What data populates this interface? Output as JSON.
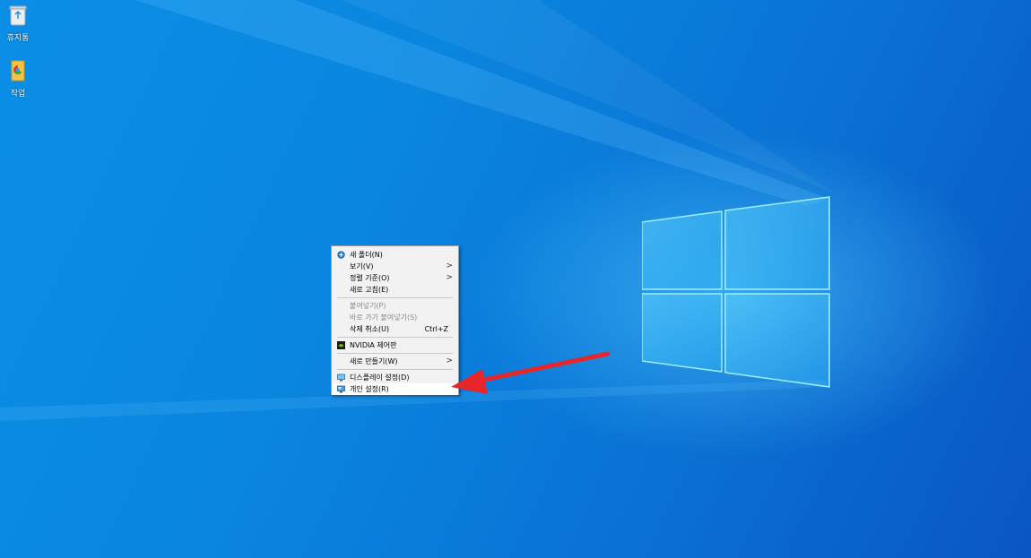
{
  "desktop": {
    "icons": [
      {
        "label": "휴지통",
        "icon": "recycle-bin-icon"
      },
      {
        "label": "작업",
        "icon": "folder-icon"
      }
    ],
    "logo": "windows-logo"
  },
  "context_menu": {
    "items": [
      {
        "label": "새 폴더(N)",
        "icon": "new-folder-icon"
      },
      {
        "label": "보기(V)",
        "submenu": ">"
      },
      {
        "label": "정렬 기준(O)",
        "submenu": ">"
      },
      {
        "label": "새로 고침(E)"
      },
      {
        "label": "붙여넣기(P)",
        "disabled": true
      },
      {
        "label": "바로 가기 붙여넣기(S)",
        "disabled": true
      },
      {
        "label": "삭제 취소(U)",
        "shortcut": "Ctrl+Z"
      },
      {
        "label": "NVIDIA 제어판",
        "icon": "nvidia-icon"
      },
      {
        "label": "새로 만들기(W)",
        "submenu": ">"
      },
      {
        "label": "디스플레이 설정(D)",
        "icon": "display-settings-icon"
      },
      {
        "label": "개인 설정(R)",
        "icon": "personalize-icon"
      }
    ]
  },
  "annotation": {
    "color": "#e8262a",
    "points_to": "개인 설정(R)"
  }
}
